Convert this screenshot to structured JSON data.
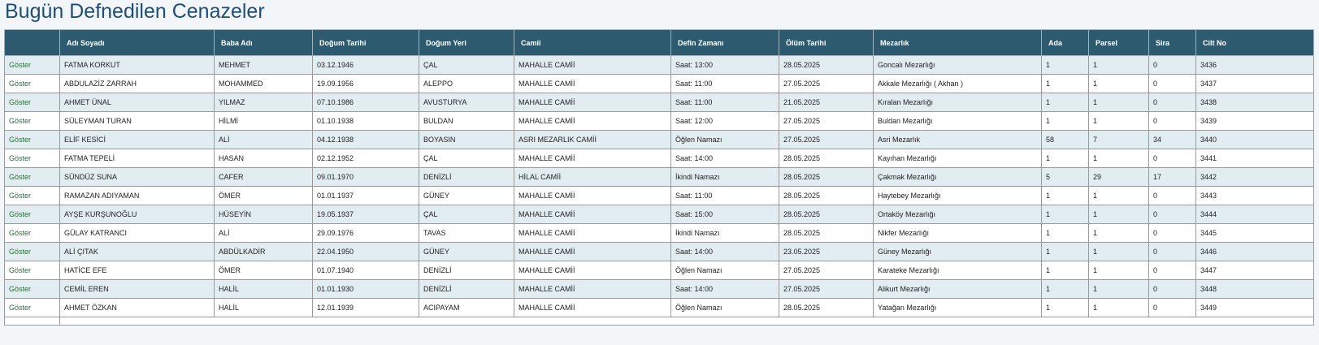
{
  "page": {
    "title": "Bugün Defnedilen Cenazeler"
  },
  "table": {
    "columns": [
      "",
      "Adı Soyadı",
      "Baba Adı",
      "Doğum Tarihi",
      "Doğum Yeri",
      "Camii",
      "Defin Zamanı",
      "Ölüm Tarihi",
      "Mezarlık",
      "Ada",
      "Parsel",
      "Sira",
      "Cilt No"
    ],
    "rows": [
      {
        "link": "Göster",
        "ad": "FATMA KORKUT",
        "baba": "MEHMET",
        "dogum_tarihi": "03.12.1946",
        "dogum_yeri": "ÇAL",
        "camii": "MAHALLE CAMİİ",
        "defin": "Saat: 13:00",
        "olum": "28.05.2025",
        "mezarlik": "Goncalı Mezarlığı",
        "ada": "1",
        "parsel": "1",
        "sira": "0",
        "cilt": "3436"
      },
      {
        "link": "Göster",
        "ad": "ABDULAZİZ ZARRAH",
        "baba": "MOHAMMED",
        "dogum_tarihi": "19.09.1956",
        "dogum_yeri": "ALEPPO",
        "camii": "MAHALLE CAMİİ",
        "defin": "Saat: 11:00",
        "olum": "27.05.2025",
        "mezarlik": "Akkale Mezarlığı ( Akhan )",
        "ada": "1",
        "parsel": "1",
        "sira": "0",
        "cilt": "3437"
      },
      {
        "link": "Göster",
        "ad": "AHMET ÜNAL",
        "baba": "YILMAZ",
        "dogum_tarihi": "07.10.1986",
        "dogum_yeri": "AVUSTURYA",
        "camii": "MAHALLE CAMİİ",
        "defin": "Saat: 11:00",
        "olum": "21.05.2025",
        "mezarlik": "Kıralan Mezarlığı",
        "ada": "1",
        "parsel": "1",
        "sira": "0",
        "cilt": "3438"
      },
      {
        "link": "Göster",
        "ad": "SÜLEYMAN TURAN",
        "baba": "HİLMİ",
        "dogum_tarihi": "01.10.1938",
        "dogum_yeri": "BULDAN",
        "camii": "MAHALLE CAMİİ",
        "defin": "Saat: 12:00",
        "olum": "27.05.2025",
        "mezarlik": "Buldan Mezarlığı",
        "ada": "1",
        "parsel": "1",
        "sira": "0",
        "cilt": "3439"
      },
      {
        "link": "Göster",
        "ad": "ELİF KESİCİ",
        "baba": "ALİ",
        "dogum_tarihi": "04.12.1938",
        "dogum_yeri": "BOYASIN",
        "camii": "ASRI MEZARLIK CAMİİ",
        "defin": "Öğlen Namazı",
        "olum": "27.05.2025",
        "mezarlik": "Asri Mezarlık",
        "ada": "58",
        "parsel": "7",
        "sira": "34",
        "cilt": "3440"
      },
      {
        "link": "Göster",
        "ad": "FATMA TEPELİ",
        "baba": "HASAN",
        "dogum_tarihi": "02.12.1952",
        "dogum_yeri": "ÇAL",
        "camii": "MAHALLE CAMİİ",
        "defin": "Saat: 14:00",
        "olum": "28.05.2025",
        "mezarlik": "Kayıhan Mezarlığı",
        "ada": "1",
        "parsel": "1",
        "sira": "0",
        "cilt": "3441"
      },
      {
        "link": "Göster",
        "ad": "SÜNDÜZ SUNA",
        "baba": "CAFER",
        "dogum_tarihi": "09.01.1970",
        "dogum_yeri": "DENİZLİ",
        "camii": "HİLAL CAMİİ",
        "defin": "İkindi Namazı",
        "olum": "28.05.2025",
        "mezarlik": "Çakmak Mezarlığı",
        "ada": "5",
        "parsel": "29",
        "sira": "17",
        "cilt": "3442"
      },
      {
        "link": "Göster",
        "ad": "RAMAZAN ADIYAMAN",
        "baba": "ÖMER",
        "dogum_tarihi": "01.01.1937",
        "dogum_yeri": "GÜNEY",
        "camii": "MAHALLE CAMİİ",
        "defin": "Saat: 11:00",
        "olum": "28.05.2025",
        "mezarlik": "Haytebey Mezarlığı",
        "ada": "1",
        "parsel": "1",
        "sira": "0",
        "cilt": "3443"
      },
      {
        "link": "Göster",
        "ad": "AYŞE KURŞUNOĞLU",
        "baba": "HÜSEYİN",
        "dogum_tarihi": "19.05.1937",
        "dogum_yeri": "ÇAL",
        "camii": "MAHALLE CAMİİ",
        "defin": "Saat: 15:00",
        "olum": "28.05.2025",
        "mezarlik": "Ortaköy Mezarlığı",
        "ada": "1",
        "parsel": "1",
        "sira": "0",
        "cilt": "3444"
      },
      {
        "link": "Göster",
        "ad": "GÜLAY KATRANCI",
        "baba": "ALİ",
        "dogum_tarihi": "29.09.1976",
        "dogum_yeri": "TAVAS",
        "camii": "MAHALLE CAMİİ",
        "defin": "İkindi Namazı",
        "olum": "28.05.2025",
        "mezarlik": "Nikfer Mezarlığı",
        "ada": "1",
        "parsel": "1",
        "sira": "0",
        "cilt": "3445"
      },
      {
        "link": "Göster",
        "ad": "ALİ ÇITAK",
        "baba": "ABDÜLKADİR",
        "dogum_tarihi": "22.04.1950",
        "dogum_yeri": "GÜNEY",
        "camii": "MAHALLE CAMİİ",
        "defin": "Saat: 14:00",
        "olum": "23.05.2025",
        "mezarlik": "Güney Mezarlığı",
        "ada": "1",
        "parsel": "1",
        "sira": "0",
        "cilt": "3446"
      },
      {
        "link": "Göster",
        "ad": "HATİCE EFE",
        "baba": "ÖMER",
        "dogum_tarihi": "01.07.1940",
        "dogum_yeri": "DENİZLİ",
        "camii": "MAHALLE CAMİİ",
        "defin": "Öğlen Namazı",
        "olum": "27.05.2025",
        "mezarlik": "Karateke Mezarlığı",
        "ada": "1",
        "parsel": "1",
        "sira": "0",
        "cilt": "3447"
      },
      {
        "link": "Göster",
        "ad": "CEMİL EREN",
        "baba": "HALİL",
        "dogum_tarihi": "01.01.1930",
        "dogum_yeri": "DENİZLİ",
        "camii": "MAHALLE CAMİİ",
        "defin": "Saat: 14:00",
        "olum": "27.05.2025",
        "mezarlik": "Alikurt Mezarlığı",
        "ada": "1",
        "parsel": "1",
        "sira": "0",
        "cilt": "3448"
      },
      {
        "link": "Göster",
        "ad": "AHMET ÖZKAN",
        "baba": "HALİL",
        "dogum_tarihi": "12.01.1939",
        "dogum_yeri": "ACIPAYAM",
        "camii": "MAHALLE CAMİİ",
        "defin": "Öğlen Namazı",
        "olum": "28.05.2025",
        "mezarlik": "Yatağan Mezarlığı",
        "ada": "1",
        "parsel": "1",
        "sira": "0",
        "cilt": "3449"
      }
    ]
  },
  "colors": {
    "header_bg": "#2e5a6f",
    "odd_row_bg": "#e2edf2",
    "link": "#2f6b3c",
    "title": "#1f4e79"
  }
}
